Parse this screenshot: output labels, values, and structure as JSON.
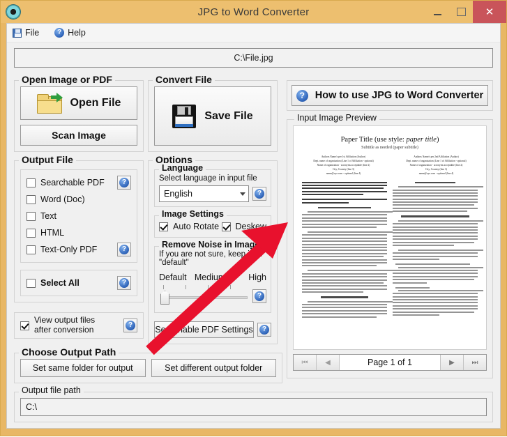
{
  "window": {
    "title": "JPG to Word Converter",
    "app_icon": "app-circle-icon",
    "minimize_label": "–",
    "maximize_label": "□",
    "close_label": "✕",
    "accent_titlebar": "#edbf6f",
    "accent_close": "#c9545a"
  },
  "menubar": {
    "items": [
      {
        "label": "File",
        "icon": "floppy-icon"
      },
      {
        "label": "Help",
        "icon": "question-circle-icon"
      }
    ]
  },
  "input_path": {
    "value": "C:\\File.jpg"
  },
  "open_group": {
    "legend": "Open Image or PDF",
    "open_file_label": "Open File",
    "open_file_icon": "open-folder-icon",
    "scan_image_label": "Scan Image"
  },
  "convert_group": {
    "legend": "Convert File",
    "save_file_label": "Save File",
    "save_file_icon": "floppy-disk-icon"
  },
  "output_file_group": {
    "legend": "Output File",
    "formats": [
      {
        "label": "Searchable PDF",
        "checked": false,
        "help": true
      },
      {
        "label": "Word (Doc)",
        "checked": false,
        "help": false
      },
      {
        "label": "Text",
        "checked": false,
        "help": false
      },
      {
        "label": "HTML",
        "checked": false,
        "help": false
      },
      {
        "label": "Text-Only PDF",
        "checked": false,
        "help": true
      }
    ],
    "select_all": {
      "label": "Select All",
      "checked": false,
      "help": true
    },
    "view_output": {
      "label": "View output files after conversion",
      "checked": true,
      "help": true
    }
  },
  "options_group": {
    "legend": "Options",
    "language": {
      "legend": "Language",
      "description": "Select language in input file",
      "selected": "English",
      "options": [
        "English"
      ],
      "help": true
    },
    "image_settings": {
      "legend": "Image Settings",
      "auto_rotate": {
        "label": "Auto Rotate",
        "checked": true
      },
      "deskew": {
        "label": "Deskew",
        "checked": true
      }
    },
    "remove_noise": {
      "legend": "Remove Noise in Image",
      "description": "If you are not sure, keep it as \"default\"",
      "scale": [
        "Default",
        "Medium",
        "High"
      ],
      "value": "Default",
      "help": true
    },
    "searchable_pdf_settings": {
      "label": "Searchable PDF Settings",
      "help": true
    }
  },
  "output_path_group": {
    "legend": "Choose Output Path",
    "same_folder_label": "Set same folder for output",
    "different_folder_label": "Set different output folder"
  },
  "output_file_path_group": {
    "legend": "Output file path",
    "value": "C:\\"
  },
  "howto_button": {
    "label": "How to use JPG to Word Converter",
    "icon": "question-circle-icon"
  },
  "preview_group": {
    "legend": "Input Image Preview",
    "document": {
      "title_prefix": "Paper Title (use style: ",
      "title_italic": "paper title",
      "title_suffix": ")",
      "subtitle": "Subtitle as needed (paper subtitle)",
      "author_left": [
        "Authors Name/s per 1st Affiliation (Author)",
        "Dept. name of organization (Line 1 of Affiliation - optional)",
        "Name of organization - acronyms acceptable (line 2)",
        "City, Country (line 3)",
        "name@xyz.com - optional (line 4)"
      ],
      "author_right": [
        "Authors Name/s per 2nd Affiliation (Author)",
        "Dept. name of organization (Line 1 of Affiliation - optional)",
        "Name of organization - acronyms acceptable (line 2)",
        "City, Country (line 3)",
        "name@xyz.com - optional (line 4)"
      ]
    },
    "pager": {
      "first_label": "⏮",
      "prev_label": "◀",
      "page_label": "Page 1 of 1",
      "next_label": "▶",
      "last_label": "⏭"
    }
  },
  "overlay": {
    "arrow_color": "#e8112d"
  },
  "icons": {
    "help_glyph": "?"
  }
}
